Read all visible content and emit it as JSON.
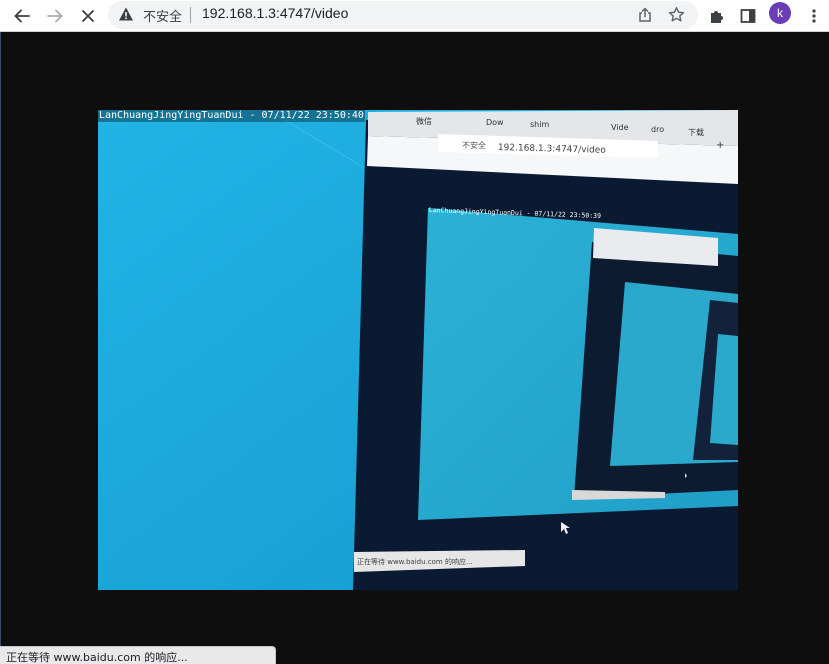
{
  "browser": {
    "security_label": "不安全",
    "url": "192.168.1.3:4747/video",
    "profile_initial": "k",
    "accent_color": "#6a3cb5"
  },
  "icons": {
    "back": "back-arrow-icon",
    "forward": "forward-arrow-icon",
    "stop": "close-icon",
    "warning": "warning-icon",
    "share": "share-icon",
    "bookmark": "star-icon",
    "extensions": "puzzle-icon",
    "side_panel": "side-panel-icon",
    "menu": "kebab-menu-icon"
  },
  "video": {
    "overlay_text": "LanChuangJingYingTuanDui - 07/11/22 23:50:40",
    "nested_overlay_text": "LanChuangJingYingTuanDui - 07/11/22 23:50:39",
    "nested_tabs": [
      "微信",
      "Dow",
      "shim",
      "Vide",
      "dro",
      "下载"
    ],
    "nested_url": "192.168.1.3:4747/video",
    "nested_security_label": "不安全",
    "nested_status": "正在等待 www.baidu.com 的响应...",
    "nested_new_tab": "+"
  },
  "status_bar": {
    "text": "正在等待 www.baidu.com 的响应..."
  }
}
